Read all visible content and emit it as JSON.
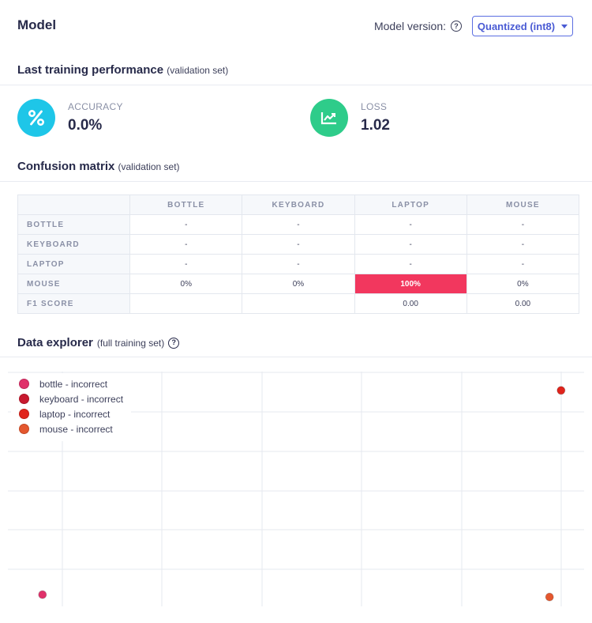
{
  "header": {
    "title": "Model",
    "version_label": "Model version:",
    "version_value": "Quantized (int8)"
  },
  "training": {
    "title": "Last training performance",
    "subtitle": "(validation set)",
    "accuracy": {
      "label": "ACCURACY",
      "value": "0.0%",
      "color": "#1ec6e8"
    },
    "loss": {
      "label": "LOSS",
      "value": "1.02",
      "color": "#2ecc8a"
    }
  },
  "confusion": {
    "title": "Confusion matrix",
    "subtitle": "(validation set)",
    "columns": [
      "BOTTLE",
      "KEYBOARD",
      "LAPTOP",
      "MOUSE"
    ],
    "rows": [
      {
        "label": "BOTTLE",
        "cells": [
          "-",
          "-",
          "-",
          "-"
        ]
      },
      {
        "label": "KEYBOARD",
        "cells": [
          "-",
          "-",
          "-",
          "-"
        ]
      },
      {
        "label": "LAPTOP",
        "cells": [
          "-",
          "-",
          "-",
          "-"
        ]
      },
      {
        "label": "MOUSE",
        "cells": [
          "0%",
          "0%",
          "100%",
          "0%"
        ]
      }
    ],
    "f1": {
      "label": "F1 SCORE",
      "cells": [
        "",
        "",
        "0.00",
        "0.00"
      ]
    },
    "highlight_color": "#f2375e"
  },
  "explorer": {
    "title": "Data explorer",
    "subtitle": "(full training set)",
    "legend": [
      {
        "label": "bottle - incorrect",
        "color": "#e0316a"
      },
      {
        "label": "keyboard - incorrect",
        "color": "#c8192f"
      },
      {
        "label": "laptop - incorrect",
        "color": "#e0241c"
      },
      {
        "label": "mouse - incorrect",
        "color": "#e4572e"
      }
    ]
  },
  "chart_data": {
    "type": "scatter",
    "title": "",
    "xlabel": "",
    "ylabel": "",
    "grid": true,
    "legend_placement": "top-left",
    "series": [
      {
        "name": "bottle - incorrect",
        "points": [
          [
            0.06,
            0.05
          ]
        ]
      },
      {
        "name": "keyboard - incorrect",
        "points": []
      },
      {
        "name": "laptop - incorrect",
        "points": [
          [
            0.96,
            0.92
          ]
        ]
      },
      {
        "name": "mouse - incorrect",
        "points": [
          [
            0.94,
            0.04
          ]
        ]
      }
    ]
  }
}
